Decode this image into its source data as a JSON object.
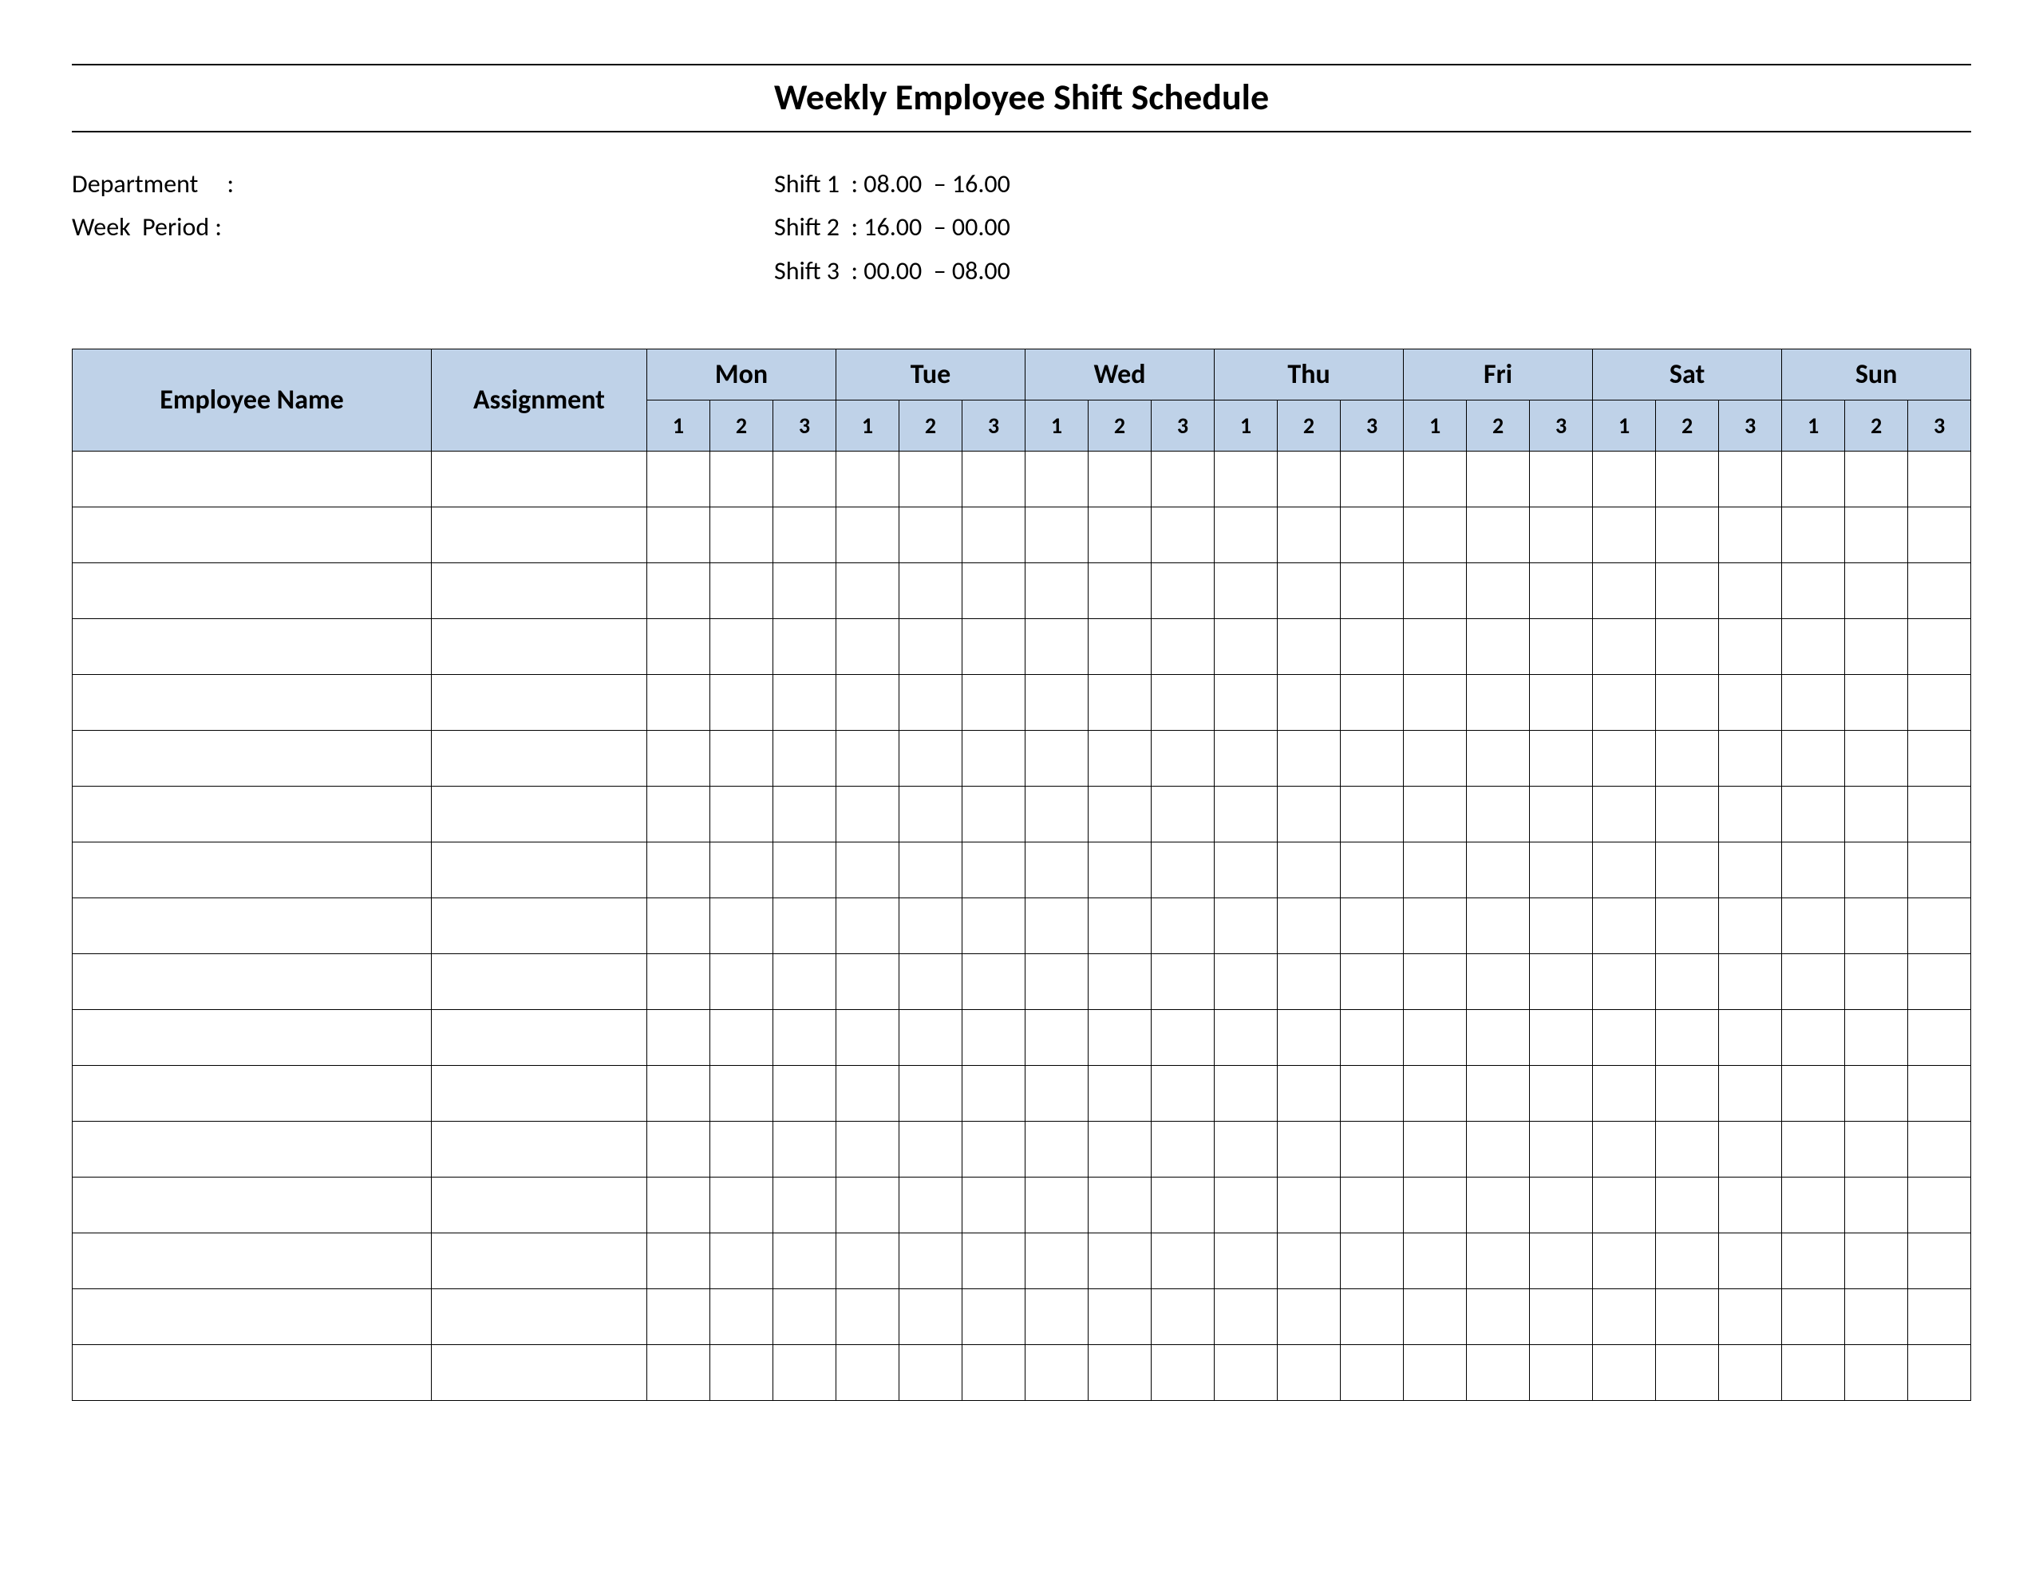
{
  "title": "Weekly Employee Shift Schedule",
  "meta": {
    "department_label": "Department",
    "department_value": "",
    "week_period_label": "Week  Period",
    "week_period_value": ""
  },
  "shifts": {
    "s1": {
      "label": "Shift 1",
      "range": "08.00  – 16.00"
    },
    "s2": {
      "label": "Shift 2",
      "range": "16.00  – 00.00"
    },
    "s3": {
      "label": "Shift 3",
      "range": "00.00  – 08.00"
    }
  },
  "headers": {
    "employee": "Employee Name",
    "assignment": "Assignment",
    "days": [
      "Mon",
      "Tue",
      "Wed",
      "Thu",
      "Fri",
      "Sat",
      "Sun"
    ],
    "sub": [
      "1",
      "2",
      "3"
    ]
  },
  "row_count": 17
}
